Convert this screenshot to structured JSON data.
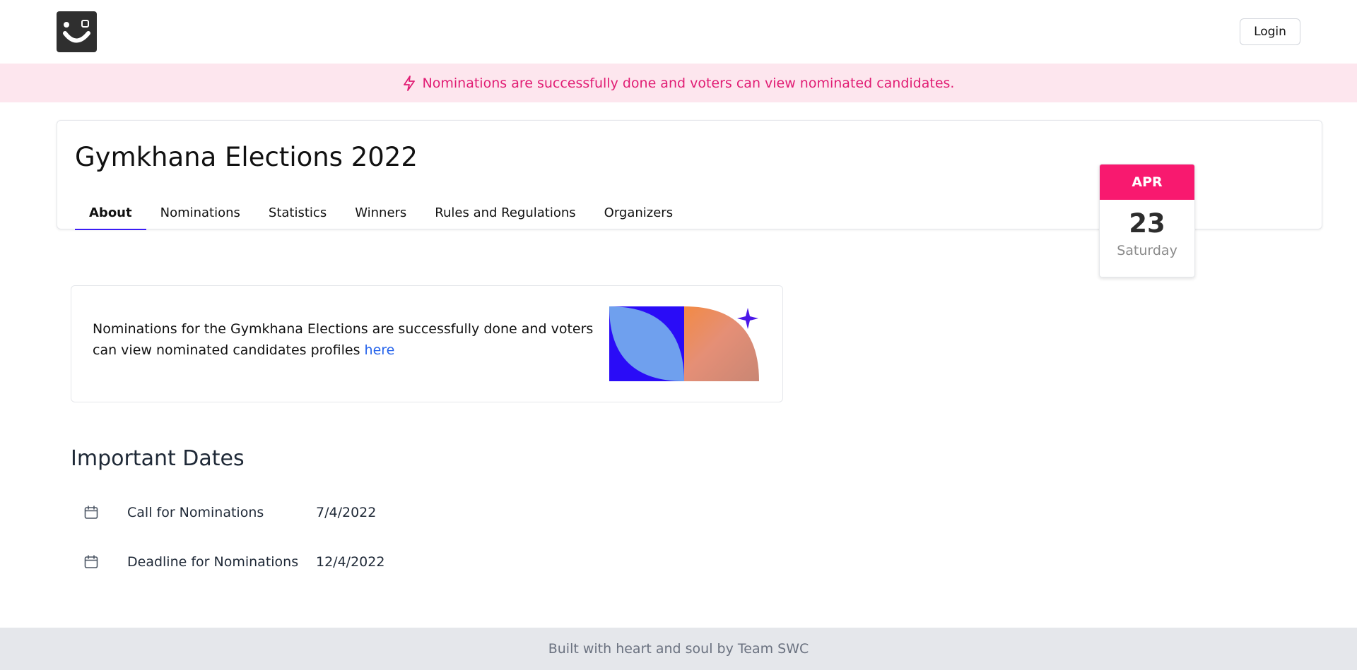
{
  "header": {
    "logo_icon": "smiley-logo-icon",
    "login_label": "Login"
  },
  "banner": {
    "icon": "lightning-icon",
    "text": "Nominations are successfully done and voters can view nominated candidates.",
    "color": "#e11d74",
    "background": "#fde6ee"
  },
  "election": {
    "title": "Gymkhana Elections 2022",
    "tabs": [
      {
        "label": "About",
        "active": true
      },
      {
        "label": "Nominations",
        "active": false
      },
      {
        "label": "Statistics",
        "active": false
      },
      {
        "label": "Winners",
        "active": false
      },
      {
        "label": "Rules and Regulations",
        "active": false
      },
      {
        "label": "Organizers",
        "active": false
      }
    ],
    "accent": "#3b1cf5"
  },
  "date_card": {
    "month": "APR",
    "day": "23",
    "weekday": "Saturday",
    "month_color": "#f8196f"
  },
  "info": {
    "text": "Nominations for the Gymkhana Elections are successfully done and voters can view nominated candidates profiles ",
    "link_label": "here"
  },
  "important_dates": {
    "heading": "Important Dates",
    "items": [
      {
        "icon": "calendar-icon",
        "label": "Call for Nominations",
        "date": "7/4/2022"
      },
      {
        "icon": "calendar-icon",
        "label": "Deadline for Nominations",
        "date": "12/4/2022"
      }
    ]
  },
  "footer": {
    "text": "Built with heart and soul by Team SWC"
  }
}
